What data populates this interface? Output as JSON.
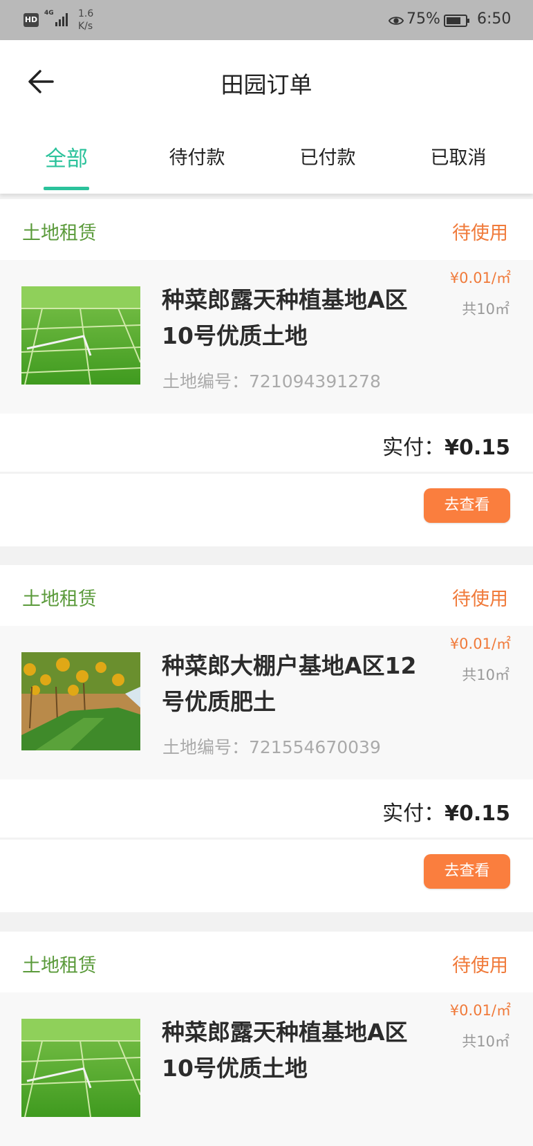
{
  "status_bar": {
    "hd": "HD",
    "network": "4G",
    "speed_value": "1.6",
    "speed_unit": "K/s",
    "battery": "75%",
    "time": "6:50"
  },
  "header": {
    "title": "田园订单",
    "tabs": [
      {
        "label": "全部",
        "active": true
      },
      {
        "label": "待付款",
        "active": false
      },
      {
        "label": "已付款",
        "active": false
      },
      {
        "label": "已取消",
        "active": false
      }
    ]
  },
  "orders": [
    {
      "category": "土地租赁",
      "status": "待使用",
      "image": "rice-field",
      "name": "种菜郎露天种植基地A区10号优质土地",
      "land_no": "土地编号：721094391278",
      "price": "¥0.01/㎡",
      "area": "共10㎡",
      "paid_label": "实付：",
      "paid_amount": "¥0.15",
      "button": "去查看"
    },
    {
      "category": "土地租赁",
      "status": "待使用",
      "image": "greenhouse-field",
      "name": "种菜郎大棚户基地A区12号优质肥土",
      "land_no": "土地编号：721554670039",
      "price": "¥0.01/㎡",
      "area": "共10㎡",
      "paid_label": "实付：",
      "paid_amount": "¥0.15",
      "button": "去查看"
    },
    {
      "category": "土地租赁",
      "status": "待使用",
      "image": "rice-field",
      "name": "种菜郎露天种植基地A区10号优质土地",
      "land_no": "",
      "price": "¥0.01/㎡",
      "area": "共10㎡",
      "paid_label": "",
      "paid_amount": "",
      "button": ""
    }
  ],
  "colors": {
    "accent": "#2bc29b",
    "category": "#5a9a3a",
    "status": "#f07a3a",
    "button": "#fa7e3e"
  }
}
